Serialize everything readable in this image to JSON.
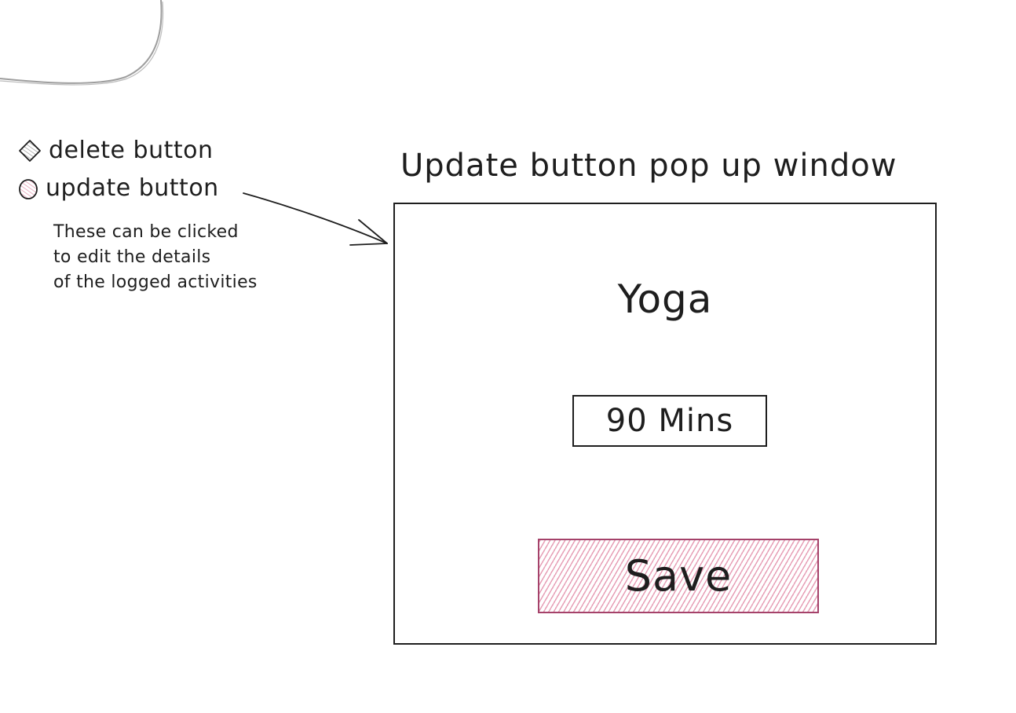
{
  "legend": {
    "delete_label": "delete button",
    "update_label": "update button",
    "note": "These can be clicked\nto edit the details\nof the logged activities"
  },
  "popup": {
    "title": "Update button pop up window",
    "activity_name": "Yoga",
    "duration_value": "90 Mins",
    "save_label": "Save"
  },
  "icons": {
    "delete": "diamond-hatched-icon",
    "update": "circle-hatched-icon"
  },
  "colors": {
    "ink": "#1e1e1e",
    "save_fill": "#e7a0b7",
    "save_stroke": "#a5426a",
    "update_icon_fill": "#e7a0b7",
    "bg_curve": "#9e9e9e"
  }
}
